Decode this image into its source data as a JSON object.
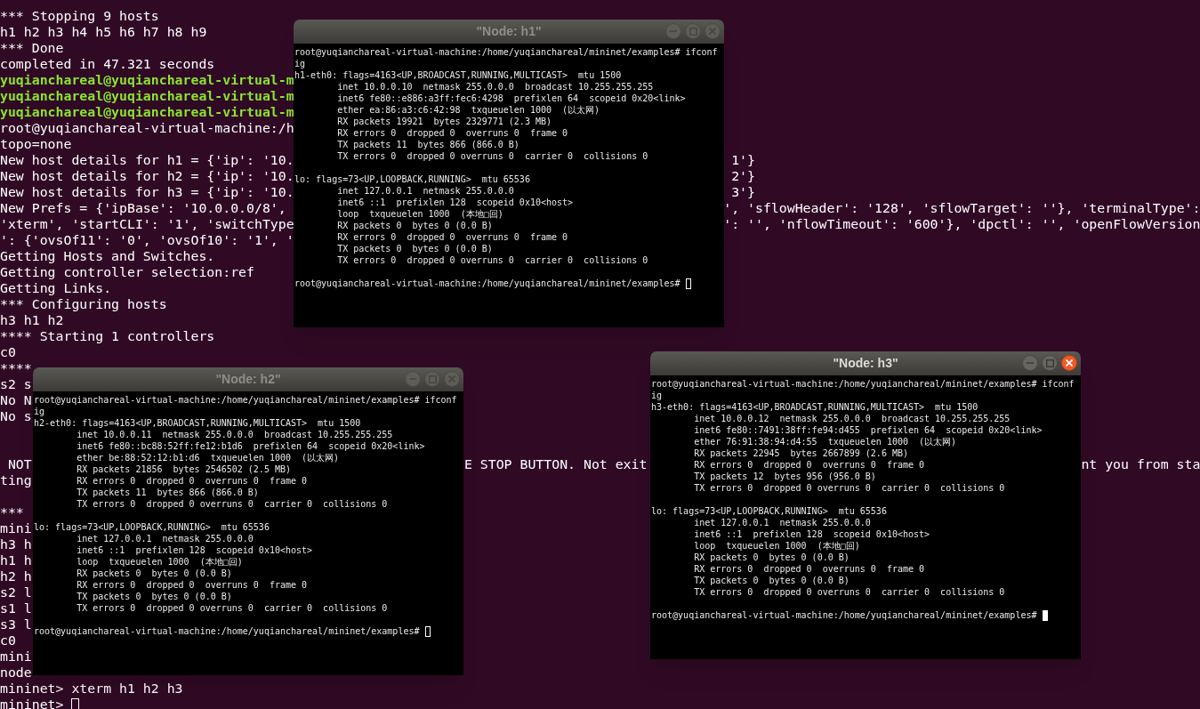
{
  "terminal": {
    "focused": false,
    "blocks": [
      [
        {
          "kind": "output",
          "segments": [
            "*** Stopping 9 hosts"
          ]
        },
        {
          "kind": "output",
          "segments": [
            "h1 h2 h3 h4 h5 h6 h7 h8 h9"
          ]
        },
        {
          "kind": "output",
          "segments": [
            "*** Done"
          ]
        },
        {
          "kind": "output",
          "segments": [
            "completed in 47.321 seconds"
          ]
        },
        {
          "kind": "prompt",
          "segments": [
            "yuqianchareal@yuqianchareal-virtual-m"
          ]
        },
        {
          "kind": "prompt",
          "segments": [
            "yuqianchareal@yuqianchareal-virtual-m"
          ]
        },
        {
          "kind": "prompt",
          "segments": [
            "yuqianchareal@yuqianchareal-virtual-m"
          ]
        },
        {
          "kind": "output",
          "segments": [
            "root@yuqianchareal-virtual-machine:/h"
          ]
        },
        {
          "kind": "output",
          "segments": [
            "topo=none"
          ]
        },
        {
          "kind": "output",
          "segments": [
            "New host details for h1 = {'ip': '10.",
            "1'}"
          ]
        },
        {
          "kind": "output",
          "segments": [
            "New host details for h2 = {'ip': '10.",
            "2'}"
          ]
        },
        {
          "kind": "output",
          "segments": [
            "New host details for h3 = {'ip': '10.",
            "3'}"
          ]
        },
        {
          "kind": "output",
          "segments": [
            "New Prefs = {'ipBase': '10.0.0.0/8',",
            "', 'sflowHeader': '128', 'sflowTarget': ''}, 'terminalType':"
          ]
        },
        {
          "kind": "output",
          "segments": [
            "'xterm', 'startCLI': '1', 'switchType",
            "': '', 'nflowTimeout': '600'}, 'dpctl': '', 'openFlowVersion"
          ]
        },
        {
          "kind": "output",
          "segments": [
            "': {'ovsOf11': '0', 'ovsOf10': '1', '"
          ]
        },
        {
          "kind": "output",
          "segments": [
            "Getting Hosts and Switches."
          ]
        },
        {
          "kind": "output",
          "segments": [
            "Getting controller selection:ref"
          ]
        },
        {
          "kind": "output",
          "segments": [
            "Getting Links."
          ]
        },
        {
          "kind": "output",
          "segments": [
            "*** Configuring hosts"
          ]
        },
        {
          "kind": "output",
          "segments": [
            "h3 h1 h2"
          ]
        },
        {
          "kind": "output",
          "segments": [
            "**** Starting 1 controllers"
          ]
        },
        {
          "kind": "output",
          "segments": [
            "c0"
          ]
        },
        {
          "kind": "output",
          "segments": [
            "****"
          ]
        },
        {
          "kind": "output",
          "segments": [
            "s2 s"
          ]
        },
        {
          "kind": "output",
          "segments": [
            "No N"
          ]
        },
        {
          "kind": "output",
          "segments": [
            "No s"
          ]
        }
      ],
      [
        {
          "kind": "output",
          "segments": [
            " NOT",
            "E STOP BUTTON. Not exit",
            "nt you from sta"
          ]
        },
        {
          "kind": "output",
          "segments": [
            "ting"
          ]
        }
      ],
      [
        {
          "kind": "output",
          "segments": [
            "***"
          ]
        },
        {
          "kind": "output",
          "segments": [
            "mini"
          ]
        },
        {
          "kind": "output",
          "segments": [
            "h3 h"
          ]
        },
        {
          "kind": "output",
          "segments": [
            "h1 h"
          ]
        },
        {
          "kind": "output",
          "segments": [
            "h2 h"
          ]
        },
        {
          "kind": "output",
          "segments": [
            "s2 l"
          ]
        },
        {
          "kind": "output",
          "segments": [
            "s1 l"
          ]
        },
        {
          "kind": "output",
          "segments": [
            "s3 l"
          ]
        },
        {
          "kind": "output",
          "segments": [
            "c0"
          ]
        },
        {
          "kind": "output",
          "segments": [
            "mini"
          ]
        },
        {
          "kind": "output",
          "segments": [
            "node"
          ]
        },
        {
          "kind": "output",
          "segments": [
            "mininet> xterm h1 h2 h3"
          ]
        },
        {
          "kind": "output",
          "segments": [
            "mininet> "
          ]
        }
      ]
    ]
  },
  "windows": [
    {
      "title": "\"Node: h1\"",
      "active": false,
      "blocks": [
        [
          "root@yuqianchareal-virtual-machine:/home/yuqianchareal/mininet/examples# ifconf",
          "ig",
          "h1-eth0: flags=4163<UP,BROADCAST,RUNNING,MULTICAST>  mtu 1500",
          "        inet 10.0.0.10  netmask 255.0.0.0  broadcast 10.255.255.255",
          "        inet6 fe80::e886:a3ff:fec6:4298  prefixlen 64  scopeid 0x20<link>",
          "        ether ea:86:a3:c6:42:98  txqueuelen 1000  (以太网)",
          "        RX packets 19921  bytes 2329771 (2.3 MB)",
          "        RX errors 0  dropped 0  overruns 0  frame 0",
          "        TX packets 11  bytes 866 (866.0 B)",
          "        TX errors 0  dropped 0 overruns 0  carrier 0  collisions 0"
        ],
        [
          "lo: flags=73<UP,LOOPBACK,RUNNING>  mtu 65536",
          "        inet 127.0.0.1  netmask 255.0.0.0",
          "        inet6 ::1  prefixlen 128  scopeid 0x10<host>",
          "        loop  txqueuelen 1000  (本地□回)",
          "        RX packets 0  bytes 0 (0.0 B)",
          "        RX errors 0  dropped 0  overruns 0  frame 0",
          "        TX packets 0  bytes 0 (0.0 B)",
          "        TX errors 0  dropped 0 overruns 0  carrier 0  collisions 0"
        ],
        [
          "root@yuqianchareal-virtual-machine:/home/yuqianchareal/mininet/examples# "
        ]
      ]
    },
    {
      "title": "\"Node: h3\"",
      "active": true,
      "blocks": [
        [
          "root@yuqianchareal-virtual-machine:/home/yuqianchareal/mininet/examples# ifconf",
          "ig",
          "h3-eth0: flags=4163<UP,BROADCAST,RUNNING,MULTICAST>  mtu 1500",
          "        inet 10.0.0.12  netmask 255.0.0.0  broadcast 10.255.255.255",
          "        inet6 fe80::7491:38ff:fe94:d455  prefixlen 64  scopeid 0x20<link>",
          "        ether 76:91:38:94:d4:55  txqueuelen 1000  (以太网)",
          "        RX packets 22945  bytes 2667899 (2.6 MB)",
          "        RX errors 0  dropped 0  overruns 0  frame 0",
          "        TX packets 12  bytes 956 (956.0 B)",
          "        TX errors 0  dropped 0 overruns 0  carrier 0  collisions 0"
        ],
        [
          "lo: flags=73<UP,LOOPBACK,RUNNING>  mtu 65536",
          "        inet 127.0.0.1  netmask 255.0.0.0",
          "        inet6 ::1  prefixlen 128  scopeid 0x10<host>",
          "        loop  txqueuelen 1000  (本地□回)",
          "        RX packets 0  bytes 0 (0.0 B)",
          "        RX errors 0  dropped 0  overruns 0  frame 0",
          "        TX packets 0  bytes 0 (0.0 B)",
          "        TX errors 0  dropped 0 overruns 0  carrier 0  collisions 0"
        ],
        [
          "root@yuqianchareal-virtual-machine:/home/yuqianchareal/mininet/examples# "
        ]
      ]
    },
    {
      "title": "\"Node: h2\"",
      "active": false,
      "blocks": [
        [
          "root@yuqianchareal-virtual-machine:/home/yuqianchareal/mininet/examples# ifconf",
          "ig",
          "h2-eth0: flags=4163<UP,BROADCAST,RUNNING,MULTICAST>  mtu 1500",
          "        inet 10.0.0.11  netmask 255.0.0.0  broadcast 10.255.255.255",
          "        inet6 fe80::bc88:52ff:fe12:b1d6  prefixlen 64  scopeid 0x20<link>",
          "        ether be:88:52:12:b1:d6  txqueuelen 1000  (以太网)",
          "        RX packets 21856  bytes 2546502 (2.5 MB)",
          "        RX errors 0  dropped 0  overruns 0  frame 0",
          "        TX packets 11  bytes 866 (866.0 B)",
          "        TX errors 0  dropped 0 overruns 0  carrier 0  collisions 0"
        ],
        [
          "lo: flags=73<UP,LOOPBACK,RUNNING>  mtu 65536",
          "        inet 127.0.0.1  netmask 255.0.0.0",
          "        inet6 ::1  prefixlen 128  scopeid 0x10<host>",
          "        loop  txqueuelen 1000  (本地□回)",
          "        RX packets 0  bytes 0 (0.0 B)",
          "        RX errors 0  dropped 0  overruns 0  frame 0",
          "        TX packets 0  bytes 0 (0.0 B)",
          "        TX errors 0  dropped 0 overruns 0  carrier 0  collisions 0"
        ],
        [
          "root@yuqianchareal-virtual-machine:/home/yuqianchareal/mininet/examples# "
        ]
      ]
    }
  ]
}
